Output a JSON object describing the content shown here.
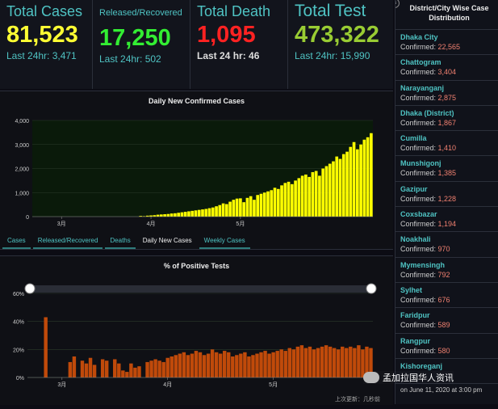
{
  "stats": [
    {
      "title": "Total Cases",
      "value": "81,523",
      "sub": "Last 24hr: 3,471",
      "color": "#ffff33"
    },
    {
      "title": "Released/Recovered",
      "value": "17,250",
      "sub": "Last 24hr: 502",
      "color": "#33ee33"
    },
    {
      "title": "Total Death",
      "value": "1,095",
      "sub": "Last 24 hr: 46",
      "color": "#ff2222"
    },
    {
      "title": "Total Test",
      "value": "473,322",
      "sub": "Last 24hr: 15,990",
      "color": "#99cc33"
    }
  ],
  "tabs": [
    {
      "label": "Cases",
      "active": false
    },
    {
      "label": "Released/Recovered",
      "active": false
    },
    {
      "label": "Deaths",
      "active": false
    },
    {
      "label": "Daily New Cases",
      "active": true
    },
    {
      "label": "Weekly Cases",
      "active": false
    }
  ],
  "sidebar": {
    "header": "District/City Wise Case Distribution",
    "menu_glyph": "≡",
    "confirmed_label": "Confirmed: ",
    "districts": [
      {
        "name": "Dhaka City",
        "confirmed": "22,565"
      },
      {
        "name": "Chattogram",
        "confirmed": "3,404"
      },
      {
        "name": "Narayanganj",
        "confirmed": "2,875"
      },
      {
        "name": "Dhaka (District)",
        "confirmed": "1,867"
      },
      {
        "name": "Cumilla",
        "confirmed": "1,410"
      },
      {
        "name": "Munshigonj",
        "confirmed": "1,385"
      },
      {
        "name": "Gazipur",
        "confirmed": "1,228"
      },
      {
        "name": "Coxsbazar",
        "confirmed": "1,194"
      },
      {
        "name": "Noakhali",
        "confirmed": "970"
      },
      {
        "name": "Mymensingh",
        "confirmed": "792"
      },
      {
        "name": "Sylhet",
        "confirmed": "676"
      },
      {
        "name": "Faridpur",
        "confirmed": "589"
      },
      {
        "name": "Rangpur",
        "confirmed": "580"
      },
      {
        "name": "Kishoreganj",
        "confirmed": ""
      }
    ],
    "update_text": "on June 11, 2020 at 3:00 pm"
  },
  "watermark": "孟加拉国华人资讯",
  "footer_note": "上次更新：几秒前",
  "chart_data": [
    {
      "type": "bar",
      "title": "Daily New Confirmed Cases",
      "color": "#ffff00",
      "xlabel": "",
      "ylabel": "",
      "ylim": [
        0,
        4000
      ],
      "yticks": [
        "0",
        "1,000",
        "2,000",
        "3,000",
        "4,000"
      ],
      "ytick_values": [
        0,
        1000,
        2000,
        3000,
        4000
      ],
      "xtick_labels": [
        "3月",
        "4月",
        "5月"
      ],
      "xtick_indices": [
        8,
        34,
        60
      ],
      "values": [
        0,
        0,
        0,
        0,
        0,
        0,
        0,
        0,
        0,
        0,
        0,
        0,
        0,
        0,
        0,
        0,
        0,
        0,
        0,
        0,
        0,
        0,
        0,
        0,
        0,
        0,
        0,
        0,
        0,
        0,
        0,
        30,
        20,
        40,
        50,
        60,
        80,
        90,
        100,
        110,
        130,
        140,
        160,
        180,
        200,
        220,
        240,
        260,
        280,
        300,
        320,
        350,
        380,
        430,
        480,
        550,
        520,
        620,
        700,
        750,
        760,
        600,
        780,
        850,
        700,
        900,
        950,
        1000,
        1050,
        1100,
        1200,
        1150,
        1300,
        1400,
        1450,
        1350,
        1500,
        1600,
        1700,
        1750,
        1650,
        1850,
        1900,
        1700,
        2000,
        2100,
        2200,
        2300,
        2500,
        2400,
        2600,
        2700,
        2900,
        3100,
        2800,
        3000,
        3200,
        3300,
        3471
      ]
    },
    {
      "type": "bar",
      "title": "% of Positive Tests",
      "color": "#c04a0a",
      "xlabel": "",
      "ylabel": "",
      "ylim": [
        0,
        60
      ],
      "yticks": [
        "0%",
        "20%",
        "40%",
        "60%"
      ],
      "ytick_values": [
        0,
        20,
        40,
        60
      ],
      "xtick_labels": [
        "3月",
        "4月",
        "5月"
      ],
      "xtick_indices": [
        8,
        34,
        60
      ],
      "values": [
        0,
        0,
        0,
        0,
        43,
        0,
        0,
        0,
        0,
        0,
        11,
        15,
        0,
        12,
        10,
        14,
        9,
        0,
        13,
        12,
        0,
        13,
        10,
        5,
        4,
        10,
        7,
        8,
        0,
        11,
        12,
        13,
        12,
        11,
        14,
        15,
        16,
        17,
        18,
        16,
        17,
        19,
        18,
        16,
        17,
        20,
        18,
        17,
        19,
        18,
        15,
        16,
        17,
        18,
        15,
        16,
        17,
        18,
        19,
        17,
        18,
        19,
        20,
        19,
        21,
        20,
        22,
        23,
        21,
        22,
        20,
        21,
        22,
        23,
        22,
        21,
        20,
        22,
        21,
        22,
        21,
        23,
        20,
        22,
        21
      ]
    }
  ]
}
